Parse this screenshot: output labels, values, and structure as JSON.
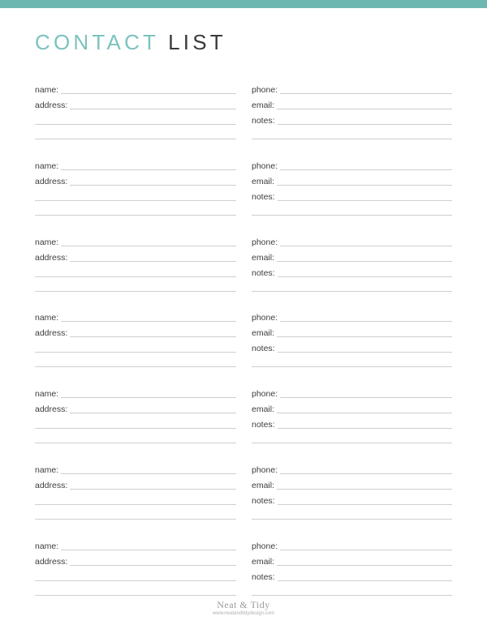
{
  "header": {
    "title_part1": "CONTACT",
    "title_part2": "LIST",
    "accent_color": "#6cb8b1"
  },
  "labels": {
    "name": "name:",
    "address": "address:",
    "phone": "phone:",
    "email": "email:",
    "notes": "notes:"
  },
  "contacts": [
    {
      "name": "",
      "address": "",
      "phone": "",
      "email": "",
      "notes": ""
    },
    {
      "name": "",
      "address": "",
      "phone": "",
      "email": "",
      "notes": ""
    },
    {
      "name": "",
      "address": "",
      "phone": "",
      "email": "",
      "notes": ""
    },
    {
      "name": "",
      "address": "",
      "phone": "",
      "email": "",
      "notes": ""
    },
    {
      "name": "",
      "address": "",
      "phone": "",
      "email": "",
      "notes": ""
    },
    {
      "name": "",
      "address": "",
      "phone": "",
      "email": "",
      "notes": ""
    },
    {
      "name": "",
      "address": "",
      "phone": "",
      "email": "",
      "notes": ""
    }
  ],
  "footer": {
    "brand": "Neat & Tidy",
    "url": "www.neatandtidydesign.com"
  }
}
